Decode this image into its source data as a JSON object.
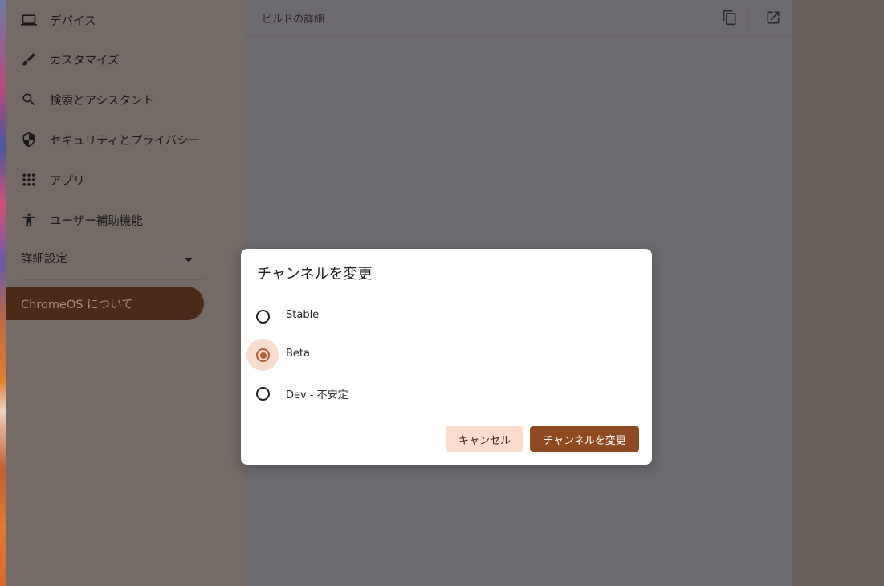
{
  "sidebar": {
    "items": [
      {
        "label": "デバイス",
        "icon": "laptop-icon"
      },
      {
        "label": "カスタマイズ",
        "icon": "brush-icon"
      },
      {
        "label": "検索とアシスタント",
        "icon": "search-icon"
      },
      {
        "label": "セキュリティとプライバシー",
        "icon": "shield-icon"
      },
      {
        "label": "アプリ",
        "icon": "apps-grid-icon"
      },
      {
        "label": "ユーザー補助機能",
        "icon": "accessibility-icon"
      }
    ],
    "advanced_label": "詳細設定",
    "about_label": "ChromeOS について"
  },
  "main": {
    "header_title": "ビルドの詳細",
    "copy_icon": "copy-icon",
    "open_icon": "open-in-new-icon"
  },
  "dialog": {
    "title": "チャンネルを変更",
    "options": [
      {
        "label": "Stable",
        "selected": false
      },
      {
        "label": "Beta",
        "selected": true
      },
      {
        "label": "Dev - 不安定",
        "selected": false
      }
    ],
    "cancel_label": "キャンセル",
    "confirm_label": "チャンネルを変更"
  },
  "colors": {
    "accent": "#8f4a22",
    "accent_light": "#fcdccc",
    "radio_selected": "#b0603a"
  }
}
